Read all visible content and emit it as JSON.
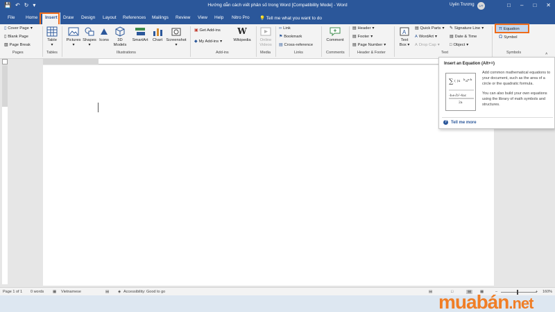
{
  "window": {
    "title": "Hướng dẫn cách viết phân số trong Word [Compatibility Mode] - Word",
    "user_name": "Uyên Trương",
    "user_initials": "UT"
  },
  "tabs": [
    "File",
    "Home",
    "Insert",
    "Draw",
    "Design",
    "Layout",
    "References",
    "Mailings",
    "Review",
    "View",
    "Help",
    "Nitro Pro"
  ],
  "active_tab": "Insert",
  "tell_me": "Tell me what you want to do",
  "ribbon": {
    "pages": {
      "label": "Pages",
      "cover_page": "Cover Page",
      "blank_page": "Blank Page",
      "page_break": "Page Break"
    },
    "tables": {
      "label": "Tables",
      "table": "Table"
    },
    "illustrations": {
      "label": "Illustrations",
      "pictures": "Pictures",
      "shapes": "Shapes",
      "icons": "Icons",
      "models_3d_a": "3D",
      "models_3d_b": "Models",
      "smartart": "SmartArt",
      "chart": "Chart",
      "screenshot": "Screenshot"
    },
    "addins": {
      "label": "Add-ins",
      "get_addins": "Get Add-ins",
      "my_addins": "My Add-ins",
      "wikipedia": "Wikipedia"
    },
    "media": {
      "label": "Media",
      "online_a": "Online",
      "online_b": "Videos"
    },
    "links": {
      "label": "Links",
      "link": "Link",
      "bookmark": "Bookmark",
      "cross_reference": "Cross-reference"
    },
    "comments": {
      "label": "Comments",
      "comment": "Comment"
    },
    "header_footer": {
      "label": "Header & Footer",
      "header": "Header",
      "footer": "Footer",
      "page_number": "Page Number"
    },
    "text": {
      "label": "Text",
      "text_box_a": "Text",
      "text_box_b": "Box",
      "quick_parts": "Quick Parts",
      "wordart": "WordArt",
      "drop_cap": "Drop Cap",
      "signature_line": "Signature Line",
      "date_time": "Date & Time",
      "object": "Object"
    },
    "symbols": {
      "label": "Symbols",
      "equation": "Equation",
      "symbol": "Symbol"
    }
  },
  "tooltip": {
    "title": "Insert an Equation (Alt+=)",
    "description_1": "Add common mathematical equations to your document, such as the area of a circle or the quadratic formula.",
    "description_2": "You can also build your own equations using the library of math symbols and structures.",
    "tell_me_more": "Tell me more"
  },
  "statusbar": {
    "page": "Page 1 of 1",
    "words": "0 words",
    "language": "Vietnamese",
    "accessibility": "Accessibility: Good to go",
    "zoom": "160%"
  },
  "watermark": {
    "main": "muabán",
    "suffix": ".net"
  },
  "colors": {
    "word_blue": "#2b579a",
    "highlight_orange": "#ef6c1a",
    "ribbon_bg": "#f3f3f3"
  }
}
